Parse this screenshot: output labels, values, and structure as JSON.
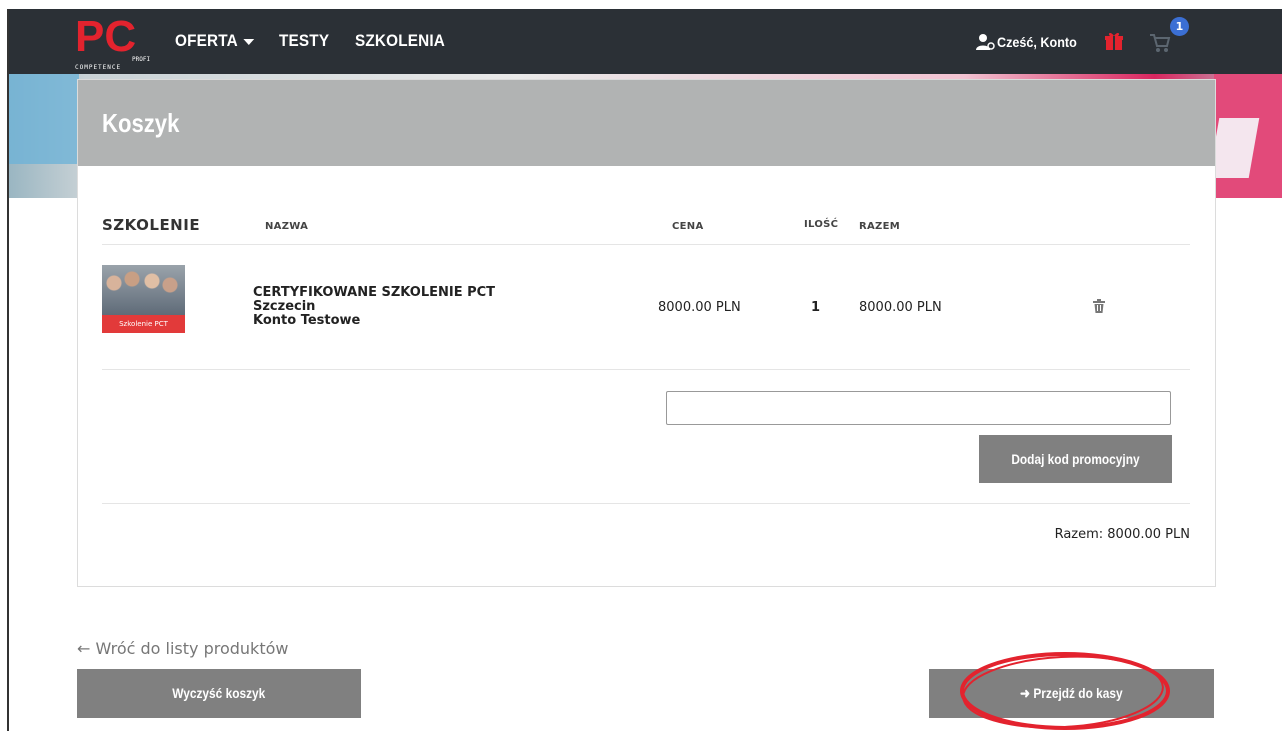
{
  "nav": {
    "logo_text": "PC",
    "logo_sub1": "PROFI",
    "logo_sub2": "COMPETENCE",
    "links": [
      "OFERTA",
      "TESTY",
      "SZKOLENIA"
    ],
    "user_greeting": "Cześć, Konto",
    "cart_count": "1"
  },
  "page": {
    "title": "Koszyk"
  },
  "cart": {
    "headers": {
      "main": "SZKOLENIE",
      "name": "NAZWA",
      "price": "CENA",
      "qty": "ILOŚĆ",
      "total": "RAZEM"
    },
    "items": [
      {
        "thumb_label": "Szkolenie PCT",
        "title": "CERTYFIKOWANE SZKOLENIE PCT",
        "city": "Szczecin",
        "account": "Konto Testowe",
        "price": "8000.00 PLN",
        "qty": "1",
        "total": "8000.00 PLN"
      }
    ],
    "promo_placeholder": "",
    "promo_button": "Dodaj kod promocyjny",
    "grand_total": "Razem: 8000.00 PLN"
  },
  "footer": {
    "back_link": "← Wróć do listy produktów",
    "clear_button": "Wyczyść koszyk",
    "checkout_button": "➜ Przejdź do kasy"
  },
  "colors": {
    "navbar": "#2b3036",
    "accent_red": "#e3232e",
    "button_gray": "#808080",
    "header_gray": "#b1b3b3",
    "badge_blue": "#3b6fd4"
  }
}
